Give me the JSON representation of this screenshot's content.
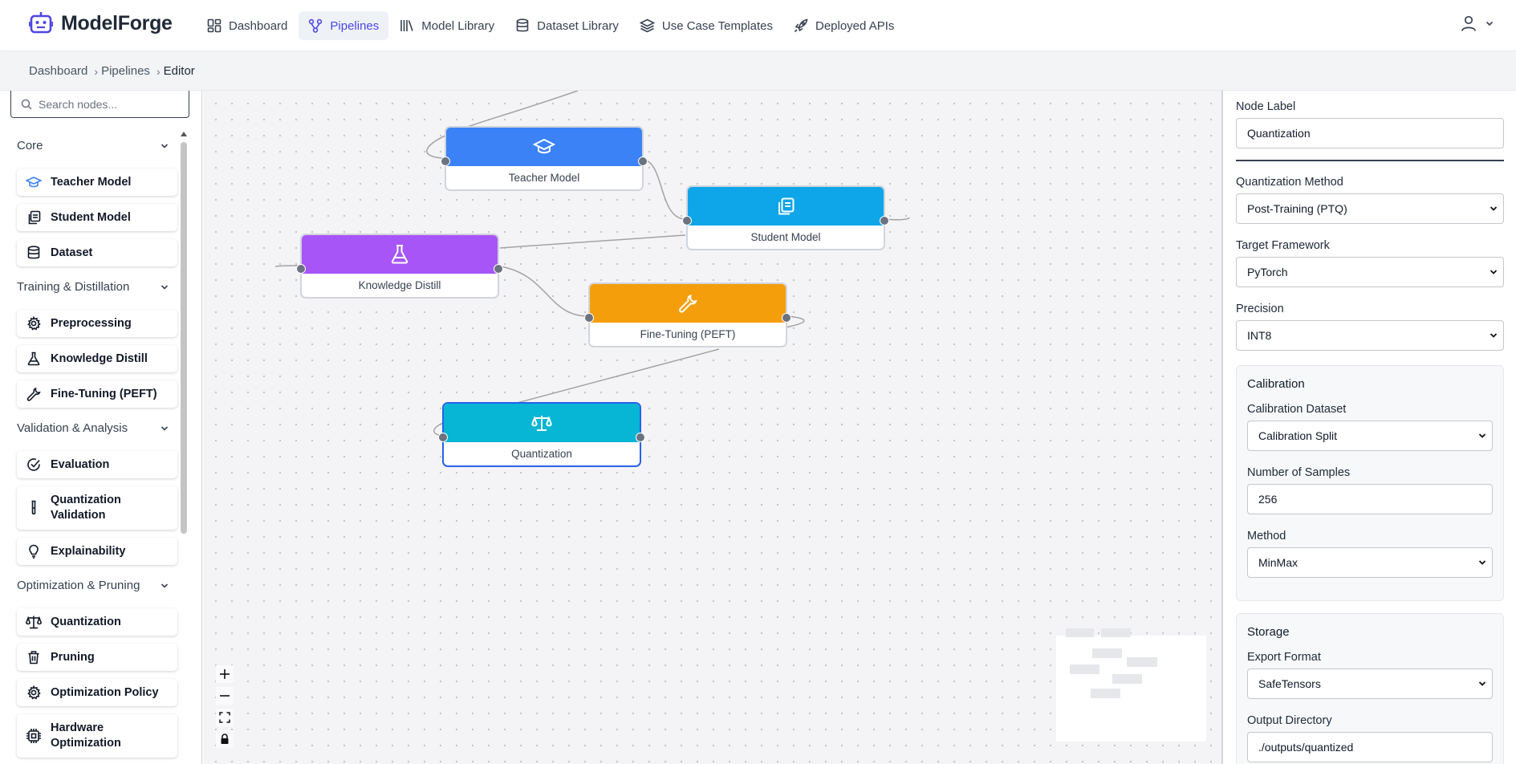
{
  "app": {
    "name": "ModelForge"
  },
  "nav": {
    "items": [
      {
        "label": "Dashboard",
        "icon": "dashboard-grid-icon",
        "active": false
      },
      {
        "label": "Pipelines",
        "icon": "pipeline-icon",
        "active": true
      },
      {
        "label": "Model Library",
        "icon": "library-icon",
        "active": false
      },
      {
        "label": "Dataset Library",
        "icon": "database-icon",
        "active": false
      },
      {
        "label": "Use Case Templates",
        "icon": "layers-icon",
        "active": false
      },
      {
        "label": "Deployed APIs",
        "icon": "rocket-icon",
        "active": false
      }
    ],
    "user_icon": "user-icon"
  },
  "breadcrumb": {
    "items": [
      "Dashboard",
      "Pipelines",
      "Editor"
    ]
  },
  "palette": {
    "search_placeholder": "Search nodes...",
    "categories": [
      {
        "name": "Core",
        "items": [
          {
            "label": "Teacher Model",
            "icon": "graduation-cap-icon"
          },
          {
            "label": "Student Model",
            "icon": "copy-icon"
          },
          {
            "label": "Dataset",
            "icon": "database-icon"
          }
        ]
      },
      {
        "name": "Training & Distillation",
        "items": [
          {
            "label": "Preprocessing",
            "icon": "gear-icon"
          },
          {
            "label": "Knowledge Distill",
            "icon": "flask-icon"
          },
          {
            "label": "Fine-Tuning (PEFT)",
            "icon": "wrench-icon"
          }
        ]
      },
      {
        "name": "Validation & Analysis",
        "items": [
          {
            "label": "Evaluation",
            "icon": "check-circle-icon"
          },
          {
            "label": "Quantization Validation",
            "icon": "test-tube-icon"
          },
          {
            "label": "Explainability",
            "icon": "lightbulb-icon"
          }
        ]
      },
      {
        "name": "Optimization & Pruning",
        "items": [
          {
            "label": "Quantization",
            "icon": "scale-icon"
          },
          {
            "label": "Pruning",
            "icon": "trash-icon"
          },
          {
            "label": "Optimization Policy",
            "icon": "gear-icon"
          },
          {
            "label": "Hardware Optimization",
            "icon": "chip-icon"
          }
        ]
      }
    ]
  },
  "canvas": {
    "nodes": [
      {
        "id": "teacher",
        "label": "Teacher Model",
        "color": "#3b82f6",
        "icon": "graduation-cap-icon",
        "selected": false
      },
      {
        "id": "student",
        "label": "Student Model",
        "color": "#0ea5e9",
        "icon": "copy-icon",
        "selected": false
      },
      {
        "id": "distill",
        "label": "Knowledge Distill",
        "color": "#a855f7",
        "icon": "flask-icon",
        "selected": false
      },
      {
        "id": "finetune",
        "label": "Fine-Tuning (PEFT)",
        "color": "#f59e0b",
        "icon": "wrench-icon",
        "selected": false
      },
      {
        "id": "quant",
        "label": "Quantization",
        "color": "#06b6d4",
        "icon": "scale-icon",
        "selected": true
      }
    ],
    "controls": [
      "zoom-in",
      "zoom-out",
      "fit-view",
      "lock"
    ]
  },
  "properties": {
    "node_label": {
      "label": "Node Label",
      "value": "Quantization"
    },
    "quantization_method": {
      "label": "Quantization Method",
      "value": "Post-Training (PTQ)"
    },
    "target_framework": {
      "label": "Target Framework",
      "value": "PyTorch"
    },
    "precision": {
      "label": "Precision",
      "value": "INT8"
    },
    "calibration": {
      "title": "Calibration",
      "dataset": {
        "label": "Calibration Dataset",
        "value": "Calibration Split"
      },
      "samples": {
        "label": "Number of Samples",
        "value": "256"
      },
      "method": {
        "label": "Method",
        "value": "MinMax"
      }
    },
    "storage": {
      "title": "Storage",
      "export_format": {
        "label": "Export Format",
        "value": "SafeTensors"
      },
      "output_dir": {
        "label": "Output Directory",
        "value": "./outputs/quantized"
      }
    }
  }
}
